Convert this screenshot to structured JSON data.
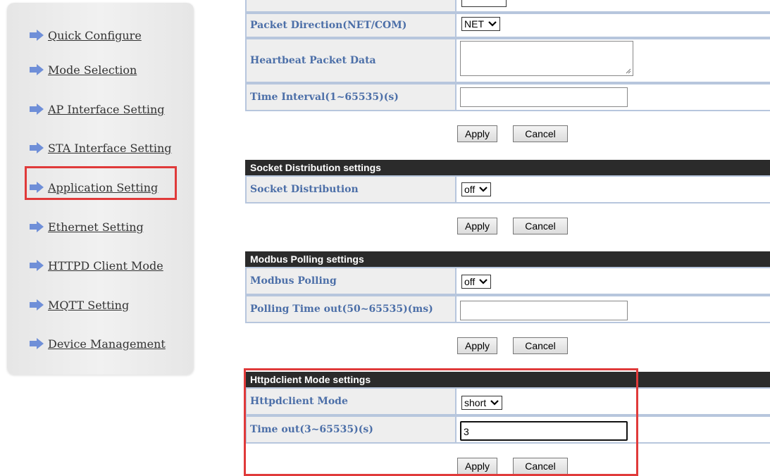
{
  "sidebar": {
    "items": [
      {
        "label": "Quick Configure",
        "icon": "arrow-right-icon"
      },
      {
        "label": "Mode Selection",
        "icon": "arrow-right-icon"
      },
      {
        "label": "AP Interface Setting",
        "icon": "arrow-right-icon"
      },
      {
        "label": "STA Interface Setting",
        "icon": "arrow-right-icon"
      },
      {
        "label": "Application Setting",
        "icon": "arrow-right-icon",
        "highlighted": true
      },
      {
        "label": "Ethernet Setting",
        "icon": "arrow-right-icon"
      },
      {
        "label": "HTTPD Client Mode",
        "icon": "arrow-right-icon"
      },
      {
        "label": "MQTT Setting",
        "icon": "arrow-right-icon"
      },
      {
        "label": "Device Management",
        "icon": "arrow-right-icon"
      }
    ]
  },
  "heartbeat": {
    "packet_direction_label": "Packet Direction(NET/COM)",
    "packet_direction_value": "NET",
    "heartbeat_data_label": "Heartbeat Packet Data",
    "heartbeat_data_value": "",
    "time_interval_label": "Time Interval(1~65535)(s)",
    "time_interval_value": ""
  },
  "socket_distribution": {
    "header": "Socket Distribution settings",
    "label": "Socket Distribution",
    "value": "off"
  },
  "modbus": {
    "header": "Modbus Polling settings",
    "polling_label": "Modbus Polling",
    "polling_value": "off",
    "timeout_label": "Polling Time out(50~65535)(ms)",
    "timeout_value": ""
  },
  "httpdclient": {
    "header": "Httpdclient Mode settings",
    "mode_label": "Httpdclient Mode",
    "mode_value": "short",
    "timeout_label": "Time out(3~65535)(s)",
    "timeout_value": "3"
  },
  "buttons": {
    "apply": "Apply",
    "cancel": "Cancel"
  },
  "colors": {
    "highlight": "#e03a3a",
    "header_bg": "#2b2b2b",
    "label_text": "#4c6fa8",
    "arrow": "#6f8fd8"
  }
}
